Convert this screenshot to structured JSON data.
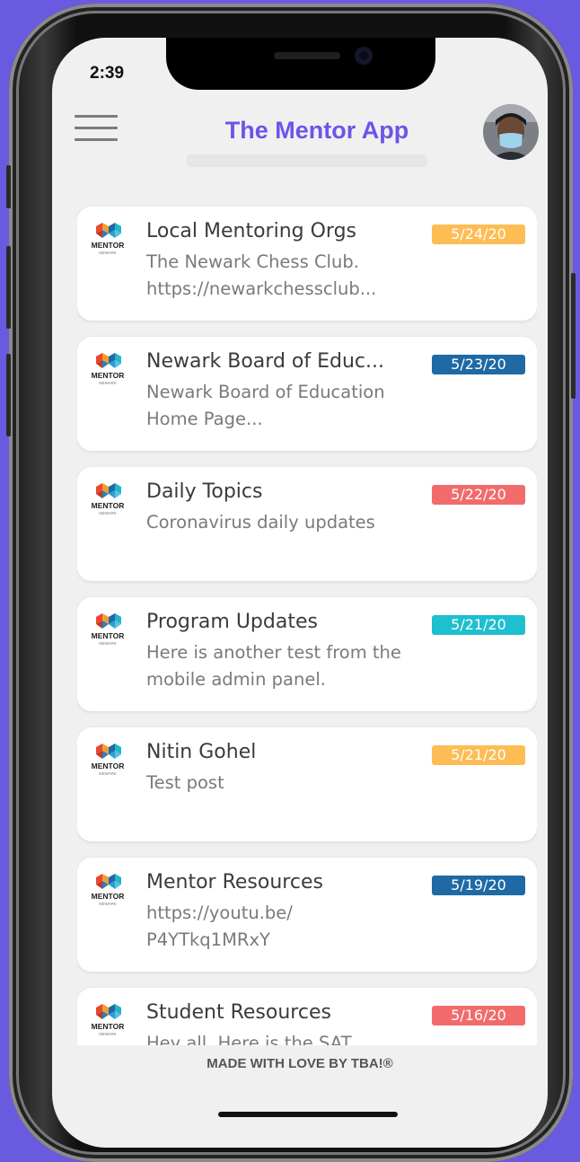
{
  "status_bar": {
    "time": "2:39"
  },
  "header": {
    "title": "The Mentor App",
    "menu_icon": "hamburger-menu-icon",
    "avatar": "user-avatar"
  },
  "logo": {
    "text": "MENTOR",
    "subtext": "NEWARK"
  },
  "posts": [
    {
      "title": "Local Mentoring Orgs",
      "body": "The Newark Chess Club. https://newarkchessclub...",
      "date": "5/24/20",
      "badge_color": "#fdbd54"
    },
    {
      "title": "Newark Board of Educ...",
      "body": "Newark Board of Education Home Page...",
      "date": "5/23/20",
      "badge_color": "#1f6aa5"
    },
    {
      "title": "Daily Topics",
      "body": "Coronavirus daily updates",
      "date": "5/22/20",
      "badge_color": "#f26b6b"
    },
    {
      "title": "Program Updates",
      "body": "Here is another test from the mobile admin panel.",
      "date": "5/21/20",
      "badge_color": "#1ebfcf"
    },
    {
      "title": "Nitin Gohel",
      "body": "Test post",
      "date": "5/21/20",
      "badge_color": "#fdbd54"
    },
    {
      "title": "Mentor Resources",
      "body": "https://youtu.be/ P4YTkq1MRxY",
      "date": "5/19/20",
      "badge_color": "#1f6aa5"
    },
    {
      "title": "Student Resources",
      "body": "Hey all. Here is the SAT",
      "date": "5/16/20",
      "badge_color": "#f26b6b"
    }
  ],
  "footer": {
    "text": "MADE WITH LOVE BY TBA!®"
  }
}
